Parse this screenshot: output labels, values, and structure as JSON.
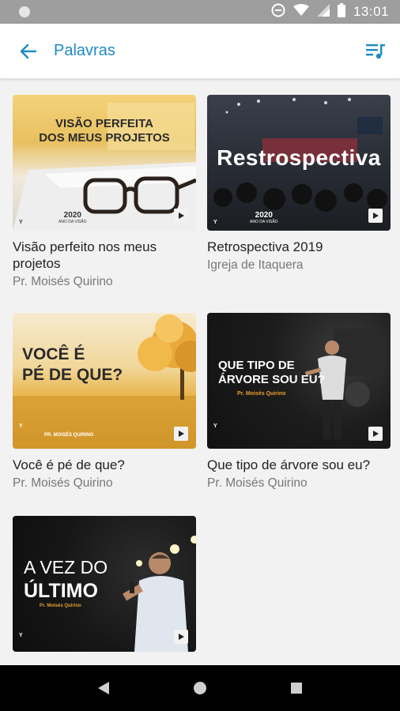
{
  "status_bar": {
    "time": "13:01"
  },
  "app_bar": {
    "title": "Palavras",
    "back_icon": "arrow-back-icon",
    "queue_icon": "playlist-icon",
    "accent": "#1e8bc3"
  },
  "items": [
    {
      "title": "Visão perfeito nos meus projetos",
      "subtitle": "Pr. Moisés Quirino",
      "thumb_text": [
        "VISÃO PERFEITA",
        "DOS MEUS PROJETOS"
      ],
      "thumb_badge": "2020",
      "thumb_badge_sub": "ANO DA VISÃO"
    },
    {
      "title": "Retrospectiva 2019",
      "subtitle": "Igreja de Itaquera",
      "thumb_text": [
        "Restrospectiva"
      ],
      "thumb_badge": "2020",
      "thumb_badge_sub": "ANO DA VISÃO"
    },
    {
      "title": "Você é pé de que?",
      "subtitle": "Pr. Moisés Quirino",
      "thumb_text": [
        "VOCÊ É",
        "PÉ DE QUE?"
      ],
      "thumb_badge": "PR. MOISÉS QUIRINO"
    },
    {
      "title": "Que tipo de árvore sou eu?",
      "subtitle": "Pr. Moisés Quirino",
      "thumb_text": [
        "QUE TIPO DE",
        "ÁRVORE SOU EU?"
      ],
      "thumb_badge": "Pr. Moisés Quirino"
    },
    {
      "title": "",
      "subtitle": "",
      "thumb_text": [
        "A VEZ DO",
        "ÚLTIMO"
      ],
      "thumb_badge": "Pr. Moisés Quirino"
    }
  ]
}
